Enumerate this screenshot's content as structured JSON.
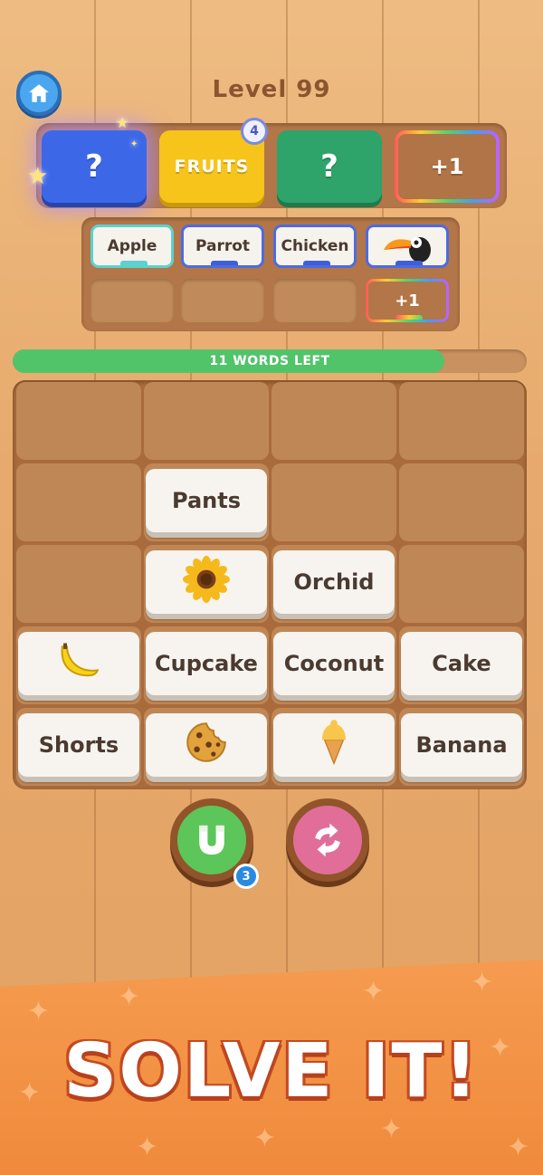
{
  "header": {
    "level_label": "Level 99"
  },
  "categories": [
    {
      "label": "?",
      "color": "#3c68e8"
    },
    {
      "label": "FRUITS",
      "color": "#f6c41b",
      "badge": "4"
    },
    {
      "label": "?",
      "color": "#2ea36a"
    },
    {
      "label": "+1",
      "color": "#b07446"
    }
  ],
  "slots": {
    "row1": [
      "Apple",
      "Parrot",
      "Chicken"
    ],
    "row1_icon": "toucan-icon",
    "plus_label": "+1"
  },
  "progress": {
    "label": "11 WORDS LEFT",
    "fraction": 0.84
  },
  "board": {
    "tiles": [
      {
        "text": "Pants"
      },
      {
        "icon": "sunflower-icon"
      },
      {
        "text": "Orchid"
      },
      {
        "icon": "banana-icon"
      },
      {
        "text": "Cupcake"
      },
      {
        "text": "Coconut"
      },
      {
        "text": "Cake"
      },
      {
        "text": "Shorts"
      },
      {
        "icon": "cookie-icon"
      },
      {
        "icon": "ice-cream-icon"
      },
      {
        "text": "Banana"
      }
    ]
  },
  "powerups": {
    "magnet_count": "3"
  },
  "banner": {
    "text": "SOLVE IT!"
  }
}
